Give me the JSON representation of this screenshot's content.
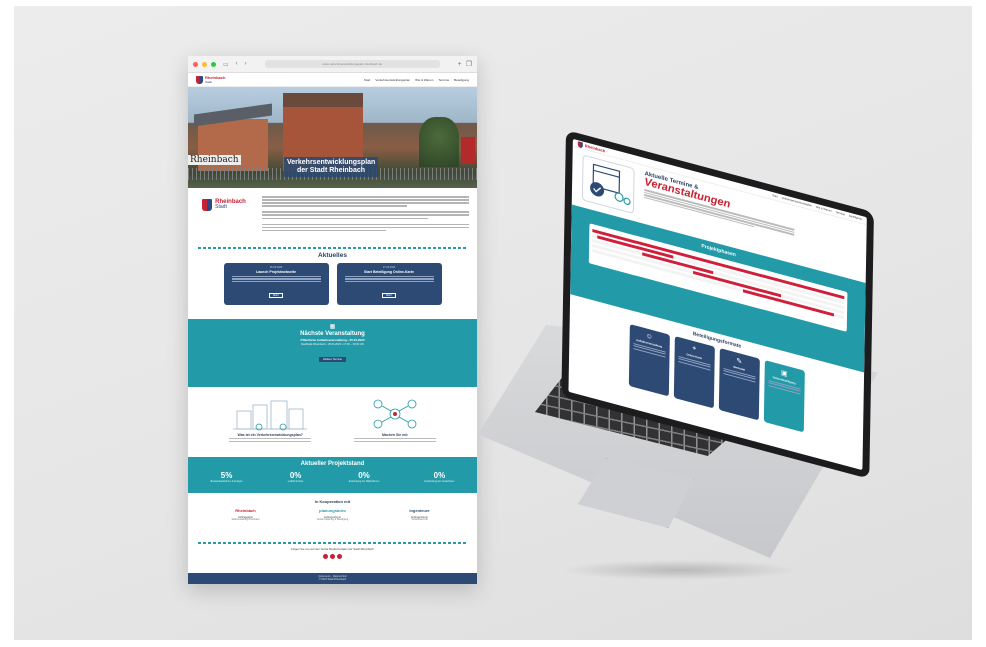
{
  "browser": {
    "url": "www.verkehrsentwicklungsplan-rheinbach.de",
    "nav_back": "‹",
    "nav_forward": "›",
    "add_tab": "+",
    "tabs_icon": "❐"
  },
  "site": {
    "logo_name": "Rheinbach",
    "logo_sub": "Stadt",
    "menu": [
      "Start",
      "Verkehrsentwicklungsplan",
      "Wie & Warum",
      "Termine",
      "Beteiligung"
    ],
    "hero_sign": "Rheinbach",
    "hero_title": "Verkehrsentwicklungsplan der Stadt Rheinbach",
    "news_title": "Aktuelles",
    "news": [
      {
        "date": "16.03.2023",
        "title": "Launch Projektwebseite",
        "button": "Mehr"
      },
      {
        "date": "17.04.2023",
        "title": "Start Beteiligung Online-Karte",
        "button": "Mehr"
      }
    ],
    "event": {
      "title": "Nächste Veranstaltung",
      "subtitle": "Öffentliche Auftaktveranstaltung • 25.04.2023",
      "location": "Stadthalle Rheinbach • 25.04.2023 • 17:30 – 20:30 Uhr",
      "button": "Weitere Termine"
    },
    "info": [
      {
        "head": "Was ist ein Verkehrsentwicklungsplan?"
      },
      {
        "head": "Machen Sie mit"
      }
    ],
    "status": {
      "title": "Aktueller Projektstand",
      "stats": [
        {
          "value": "5%",
          "label": "Bestandsaufnahme & Analyse"
        },
        {
          "value": "0%",
          "label": "Leitbild & Ziele"
        },
        {
          "value": "0%",
          "label": "Erarbeitung der Maßnahmen"
        },
        {
          "value": "0%",
          "label": "Erarbeitung des Gutachtens"
        }
      ]
    },
    "coop": {
      "head": "In Kooperation mit",
      "partners": [
        {
          "logo": "Rheinbach",
          "role": "Auftraggeber",
          "desc": "Stadtverwaltung Rheinbach"
        },
        {
          "logo": "planungsbüro",
          "role": "Auftragnehmer",
          "desc": "Verkehrsplanung & Beteiligung"
        },
        {
          "logo": "Ingenieure",
          "role": "Auftragnehmer",
          "desc": "Verkehrstechnik"
        }
      ]
    },
    "follow": "Folgen Sie uns auf den Social Media Kanälen der Stadt Rheinbach",
    "footer_links": "Impressum · Datenschutz",
    "footer_copy": "© 2023 Stadt Rheinbach"
  },
  "laptop": {
    "menu": [
      "Start",
      "Verkehrsentwicklungsplan",
      "Wie & Warum",
      "Termine",
      "Beteiligung"
    ],
    "hero_small": "Aktuelle Termine &",
    "hero_big": "Veranstaltungen",
    "timeline_title": "Projektphasen",
    "participation_title": "Beteiligungsformate",
    "cards": [
      "Auftaktveranstaltung",
      "Online-Karte",
      "Werkstatt",
      "Online-Beteiligung"
    ]
  },
  "colors": {
    "teal": "#239aa7",
    "navy": "#2d4a75",
    "red": "#c52233"
  }
}
